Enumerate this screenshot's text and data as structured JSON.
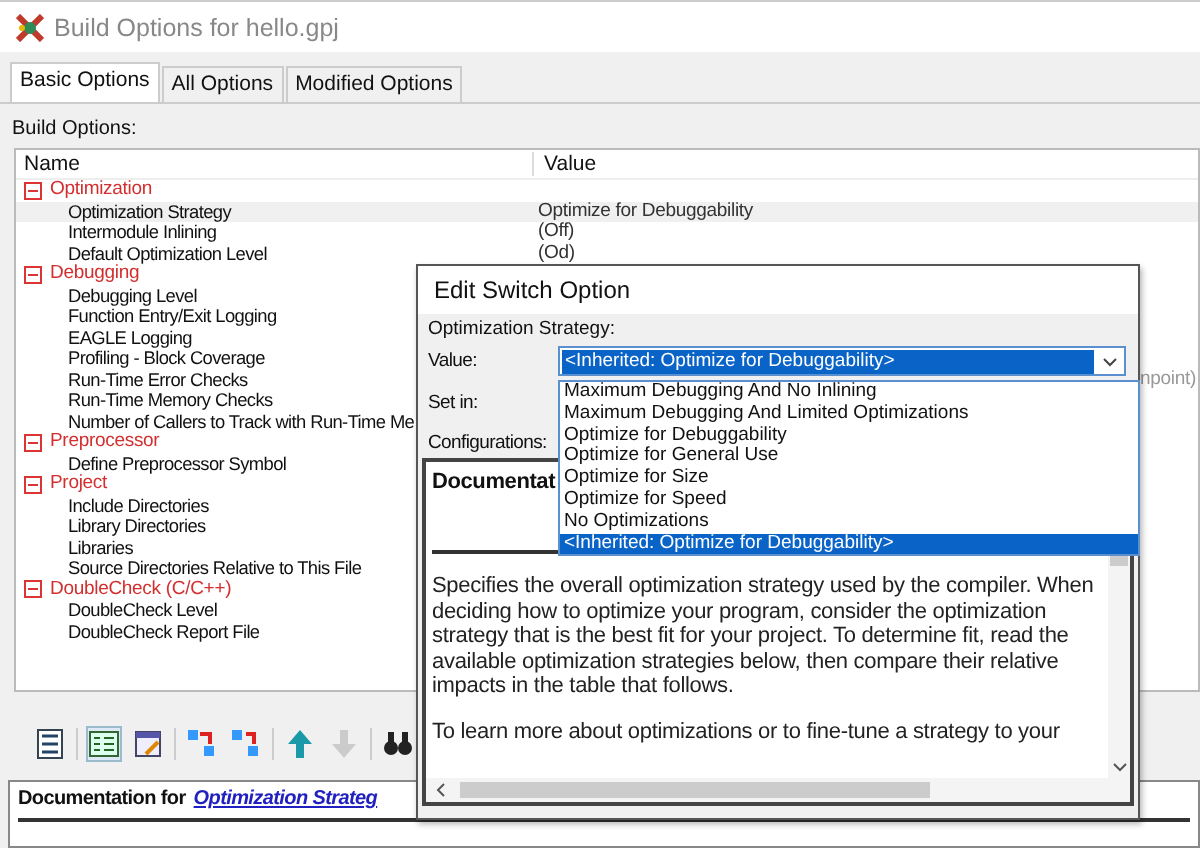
{
  "window": {
    "title": "Build Options for hello.gpj"
  },
  "tabs": [
    {
      "label": "Basic Options",
      "selected": true
    },
    {
      "label": "All Options",
      "selected": false
    },
    {
      "label": "Modified Options",
      "selected": false
    }
  ],
  "section_label": "Build Options:",
  "tree": {
    "columns": [
      "Name",
      "Value"
    ],
    "items": [
      {
        "name": "Optimization",
        "expanded": true,
        "children": [
          {
            "name": "Optimization Strategy",
            "value": "Optimize for Debuggability",
            "selected": true
          },
          {
            "name": "Intermodule Inlining",
            "value": "(Off)",
            "selected": false
          },
          {
            "name": "Default Optimization Level",
            "value": "(Od)",
            "selected": false
          }
        ]
      },
      {
        "name": "Debugging",
        "expanded": true,
        "children": [
          {
            "name": "Debugging Level",
            "selected": false
          },
          {
            "name": "Function Entry/Exit Logging",
            "selected": false
          },
          {
            "name": "EAGLE Logging",
            "selected": false
          },
          {
            "name": "Profiling - Block Coverage",
            "selected": false
          },
          {
            "name": "Run-Time Error Checks",
            "value_tail": "npoint)",
            "selected": false
          },
          {
            "name": "Run-Time Memory Checks",
            "selected": false
          },
          {
            "name": "Number of Callers to Track with Run-Time Me",
            "selected": false
          }
        ]
      },
      {
        "name": "Preprocessor",
        "expanded": true,
        "children": [
          {
            "name": "Define Preprocessor Symbol",
            "selected": false
          }
        ]
      },
      {
        "name": "Project",
        "expanded": true,
        "children": [
          {
            "name": "Include Directories",
            "selected": false
          },
          {
            "name": "Library Directories",
            "selected": false
          },
          {
            "name": "Libraries",
            "selected": false
          },
          {
            "name": "Source Directories Relative to This File",
            "selected": false
          }
        ]
      },
      {
        "name": "DoubleCheck (C/C++)",
        "expanded": true,
        "children": [
          {
            "name": "DoubleCheck Level",
            "selected": false
          },
          {
            "name": "DoubleCheck Report File",
            "selected": false
          }
        ]
      }
    ]
  },
  "toolbar": [
    {
      "kind": "sort",
      "pressed": false,
      "disabled": false
    },
    {
      "kind": "list",
      "pressed": true,
      "disabled": false
    },
    {
      "kind": "edit",
      "pressed": false,
      "disabled": false
    },
    {
      "kind": "add",
      "pressed": false,
      "disabled": false
    },
    {
      "kind": "remove",
      "pressed": false,
      "disabled": false
    },
    {
      "kind": "up",
      "pressed": false,
      "disabled": false
    },
    {
      "kind": "down",
      "pressed": false,
      "disabled": true
    },
    {
      "kind": "find",
      "pressed": false,
      "disabled": false
    }
  ],
  "documentation": {
    "heading": "Documentation for",
    "link": "Optimization Strateg"
  },
  "dialog": {
    "title": "Edit Switch Option",
    "option_label": "Optimization Strategy:",
    "value_label": "Value:",
    "value": "<Inherited: Optimize for Debuggability>",
    "set_in_label": "Set in:",
    "configurations_label": "Configurations:",
    "dropdown": [
      {
        "label": "Maximum Debugging And No Inlining",
        "selected": false
      },
      {
        "label": "Maximum Debugging And Limited Optimizations",
        "selected": false
      },
      {
        "label": "Optimize for Debuggability",
        "selected": false
      },
      {
        "label": "Optimize for General Use",
        "selected": false
      },
      {
        "label": "Optimize for Size",
        "selected": false
      },
      {
        "label": "Optimize for Speed",
        "selected": false
      },
      {
        "label": "No Optimizations",
        "selected": false
      },
      {
        "label": "<Inherited: Optimize for Debuggability>",
        "selected": true
      }
    ],
    "doc": {
      "heading": "Documentat",
      "paragraphs": [
        "Specifies the overall optimization strategy used by the compiler. When deciding how to optimize your program, consider the optimization strategy that is the best fit for your project. To determine fit, read the available optimization strategies below, then compare their relative impacts in the table that follows.",
        "To learn more about optimizations or to fine-tune a strategy to your"
      ]
    }
  }
}
